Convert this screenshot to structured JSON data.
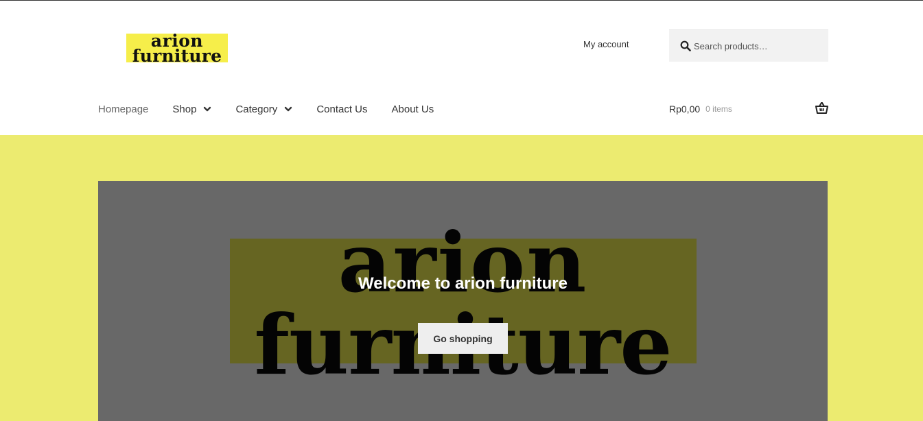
{
  "colors": {
    "logo_highlight": "#f6ee4a",
    "hero_background": "#eceb70",
    "hero_overlay": "#686868",
    "button_bg": "#eeeeee"
  },
  "header": {
    "logo": {
      "line1": "arion",
      "line2": "furniture"
    },
    "account_link": "My account",
    "search": {
      "placeholder": "Search products…",
      "value": "",
      "icon": "search-icon"
    }
  },
  "nav": {
    "items": [
      {
        "label": "Homepage",
        "has_dropdown": false,
        "active": true
      },
      {
        "label": "Shop",
        "has_dropdown": true
      },
      {
        "label": "Category",
        "has_dropdown": true
      },
      {
        "label": "Contact Us",
        "has_dropdown": false
      },
      {
        "label": "About Us",
        "has_dropdown": false
      }
    ]
  },
  "cart": {
    "amount": "Rp0,00",
    "count": "0 items",
    "icon": "basket-icon"
  },
  "hero": {
    "background_text_line1": "arion",
    "background_text_line2": "furniture",
    "title": "Welcome to arion furniture",
    "button_label": "Go shopping"
  }
}
